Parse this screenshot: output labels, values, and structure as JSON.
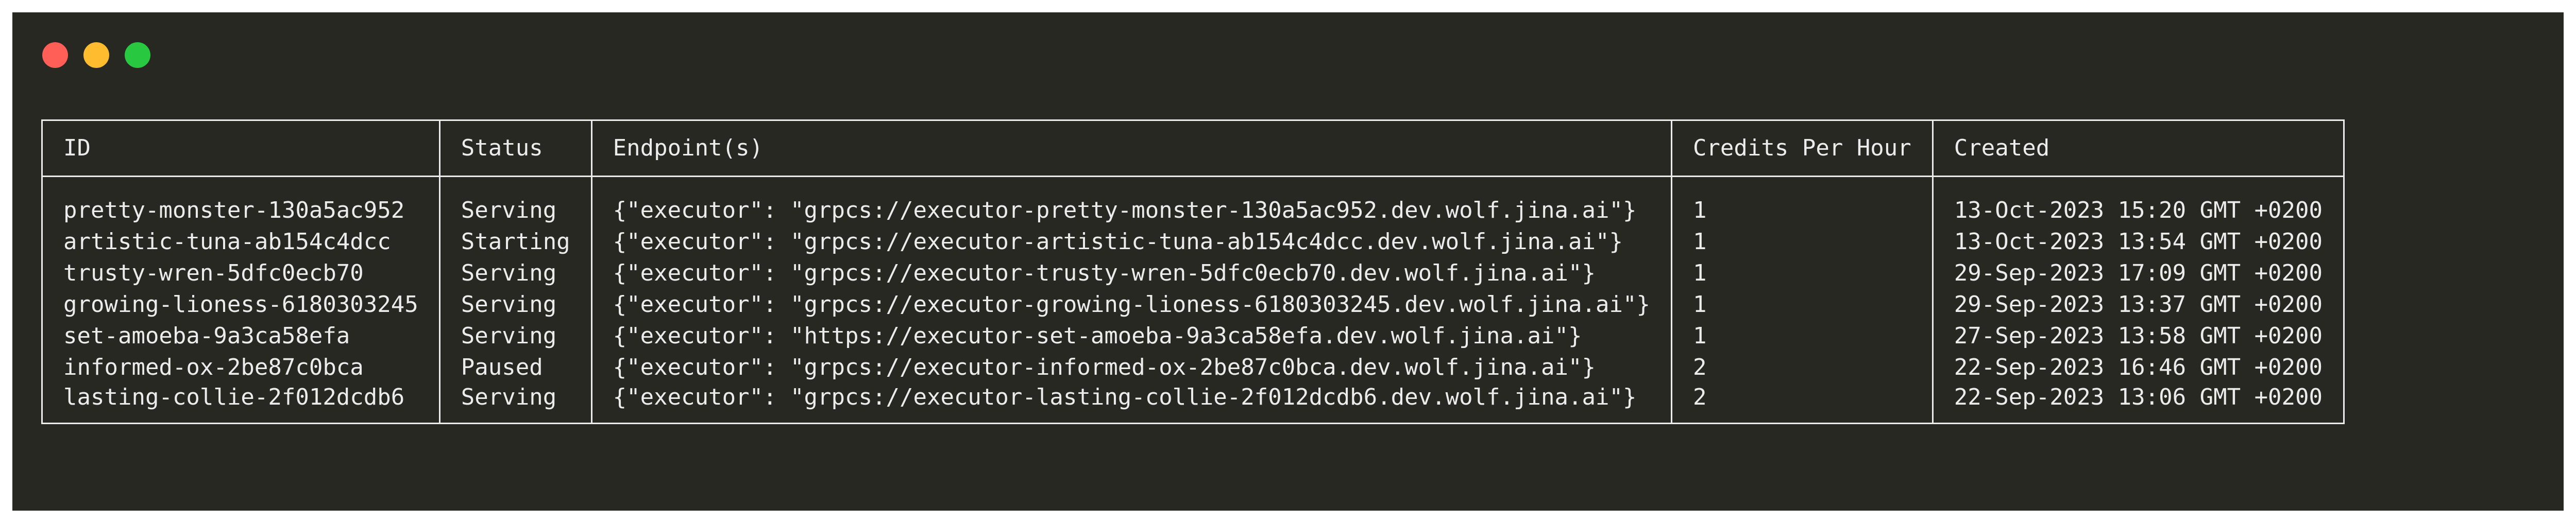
{
  "window": {
    "controls": [
      "close",
      "minimize",
      "maximize"
    ]
  },
  "table": {
    "columns": [
      "ID",
      "Status",
      "Endpoint(s)",
      "Credits Per Hour",
      "Created"
    ],
    "rows": [
      {
        "id": "pretty-monster-130a5ac952",
        "status": "Serving",
        "endpoint": "{\"executor\": \"grpcs://executor-pretty-monster-130a5ac952.dev.wolf.jina.ai\"}",
        "credits": "1",
        "created": "13-Oct-2023 15:20 GMT +0200"
      },
      {
        "id": "artistic-tuna-ab154c4dcc",
        "status": "Starting",
        "endpoint": "{\"executor\": \"grpcs://executor-artistic-tuna-ab154c4dcc.dev.wolf.jina.ai\"}",
        "credits": "1",
        "created": "13-Oct-2023 13:54 GMT +0200"
      },
      {
        "id": "trusty-wren-5dfc0ecb70",
        "status": "Serving",
        "endpoint": "{\"executor\": \"grpcs://executor-trusty-wren-5dfc0ecb70.dev.wolf.jina.ai\"}",
        "credits": "1",
        "created": "29-Sep-2023 17:09 GMT +0200"
      },
      {
        "id": "growing-lioness-6180303245",
        "status": "Serving",
        "endpoint": "{\"executor\": \"grpcs://executor-growing-lioness-6180303245.dev.wolf.jina.ai\"}",
        "credits": "1",
        "created": "29-Sep-2023 13:37 GMT +0200"
      },
      {
        "id": "set-amoeba-9a3ca58efa",
        "status": "Serving",
        "endpoint": "{\"executor\": \"https://executor-set-amoeba-9a3ca58efa.dev.wolf.jina.ai\"}",
        "credits": "1",
        "created": "27-Sep-2023 13:58 GMT +0200"
      },
      {
        "id": "informed-ox-2be87c0bca",
        "status": "Paused",
        "endpoint": "{\"executor\": \"grpcs://executor-informed-ox-2be87c0bca.dev.wolf.jina.ai\"}",
        "credits": "2",
        "created": "22-Sep-2023 16:46 GMT +0200"
      },
      {
        "id": "lasting-collie-2f012dcdb6",
        "status": "Serving",
        "endpoint": "{\"executor\": \"grpcs://executor-lasting-collie-2f012dcdb6.dev.wolf.jina.ai\"}",
        "credits": "2",
        "created": "22-Sep-2023 13:06 GMT +0200"
      }
    ]
  },
  "colors": {
    "background": "#272822",
    "text": "#ececec",
    "close": "#ff5f57",
    "minimize": "#febc2e",
    "maximize": "#28c840"
  }
}
